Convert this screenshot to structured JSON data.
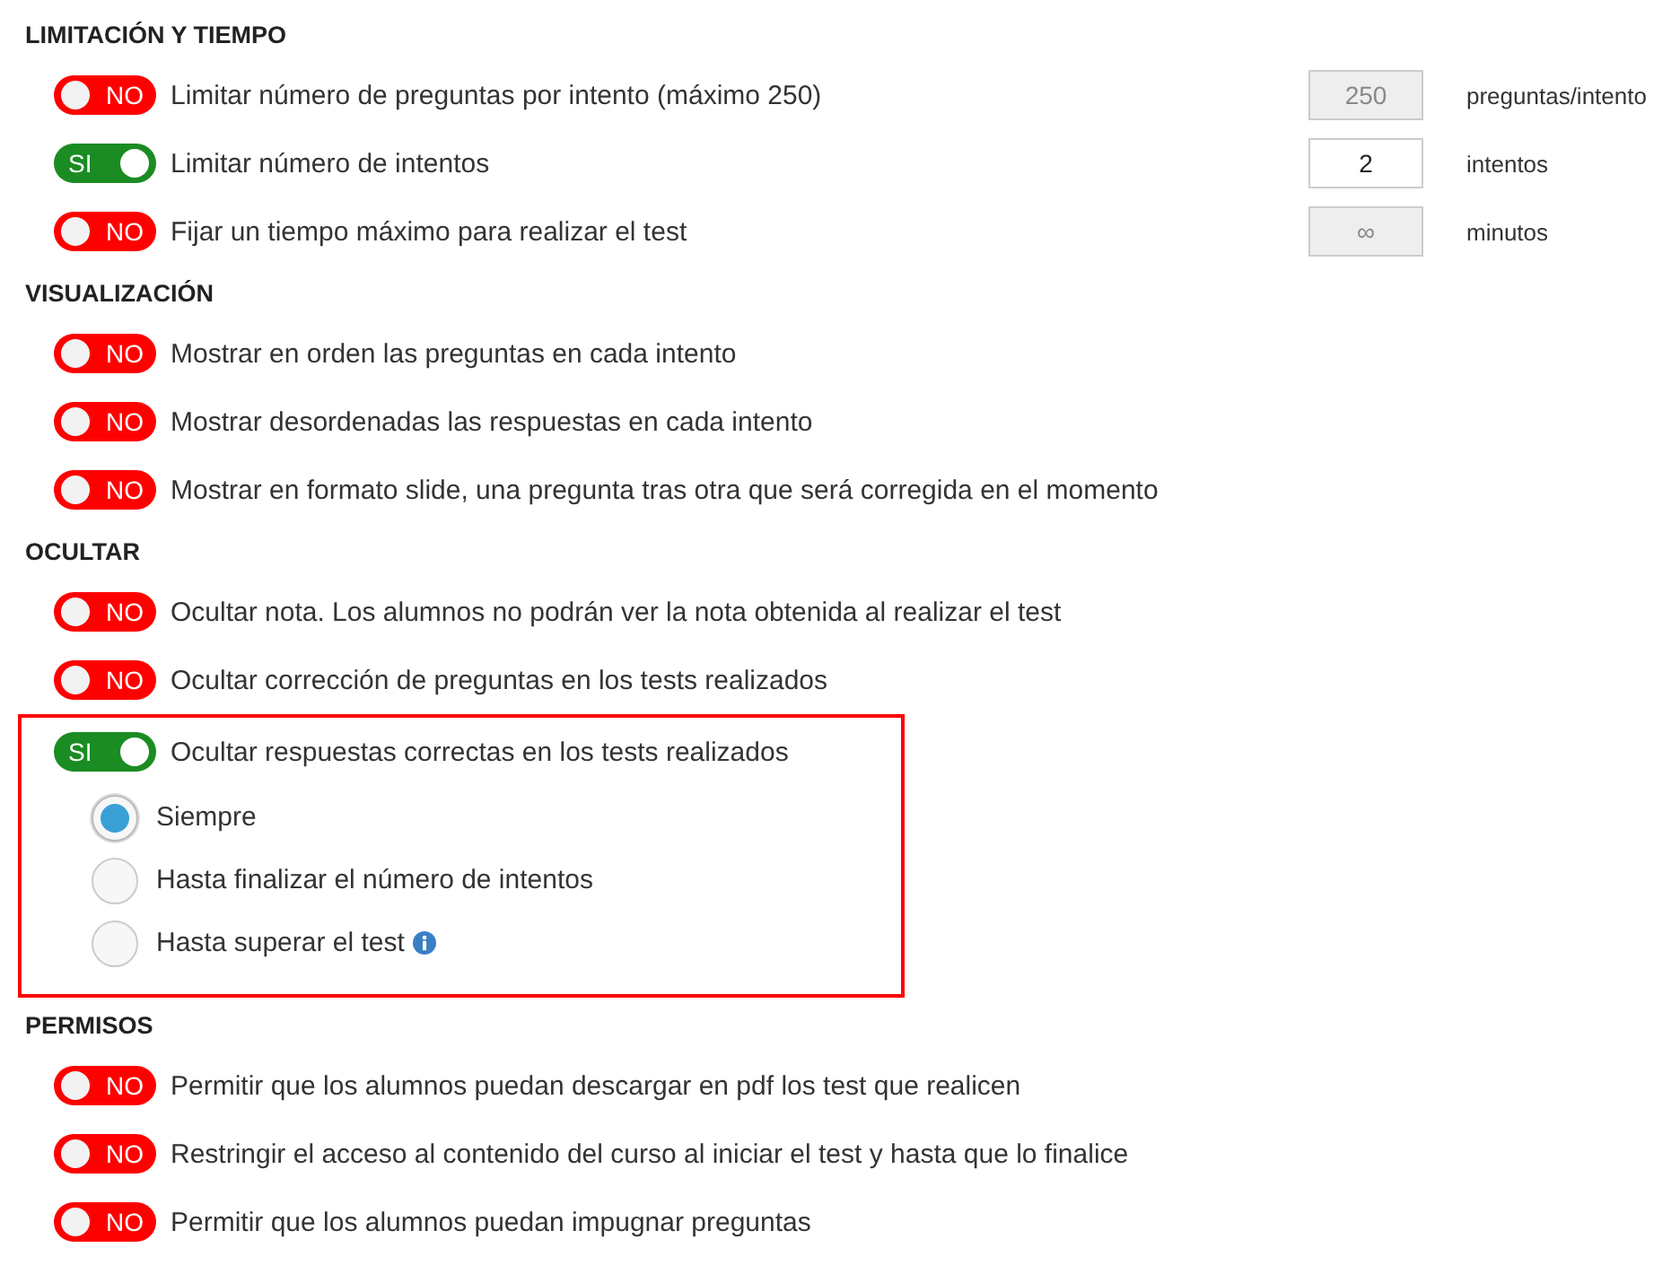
{
  "sections": [
    {
      "title": "LIMITACIÓN Y TIEMPO",
      "items": [
        {
          "toggle": "NO",
          "on": false,
          "text": "Limitar número de preguntas por intento (máximo 250)",
          "field": {
            "value": "250",
            "disabled": true,
            "unit": "preguntas/intento"
          }
        },
        {
          "toggle": "SI",
          "on": true,
          "text": "Limitar número de intentos",
          "field": {
            "value": "2",
            "disabled": false,
            "unit": "intentos"
          }
        },
        {
          "toggle": "NO",
          "on": false,
          "text": "Fijar un tiempo máximo para realizar el test",
          "field": {
            "value": "∞",
            "disabled": true,
            "unit": "minutos"
          }
        }
      ]
    },
    {
      "title": "VISUALIZACIÓN",
      "items": [
        {
          "toggle": "NO",
          "on": false,
          "text": "Mostrar en orden las preguntas en cada intento"
        },
        {
          "toggle": "NO",
          "on": false,
          "text": "Mostrar desordenadas las respuestas en cada intento"
        },
        {
          "toggle": "NO",
          "on": false,
          "text": "Mostrar en formato slide, una pregunta tras otra que será corregida en el momento"
        }
      ]
    },
    {
      "title": "OCULTAR",
      "items": [
        {
          "toggle": "NO",
          "on": false,
          "text": "Ocultar nota. Los alumnos no podrán ver la nota obtenida al realizar el test"
        },
        {
          "toggle": "NO",
          "on": false,
          "text": "Ocultar corrección de preguntas en los tests realizados"
        },
        {
          "toggle": "SI",
          "on": true,
          "highlighted": true,
          "text": "Ocultar respuestas correctas en los tests realizados",
          "options": [
            {
              "label": "Siempre",
              "selected": true
            },
            {
              "label": "Hasta finalizar el número de intentos",
              "selected": false
            },
            {
              "label": "Hasta superar el test",
              "selected": false,
              "info": true
            }
          ]
        }
      ]
    },
    {
      "title": "PERMISOS",
      "items": [
        {
          "toggle": "NO",
          "on": false,
          "text": "Permitir que los alumnos puedan descargar en pdf los test que realicen"
        },
        {
          "toggle": "NO",
          "on": false,
          "text": "Restringir el acceso al contenido del curso al iniciar el test y hasta que lo finalice"
        },
        {
          "toggle": "NO",
          "on": false,
          "text": "Permitir que los alumnos puedan impugnar preguntas"
        }
      ]
    }
  ]
}
